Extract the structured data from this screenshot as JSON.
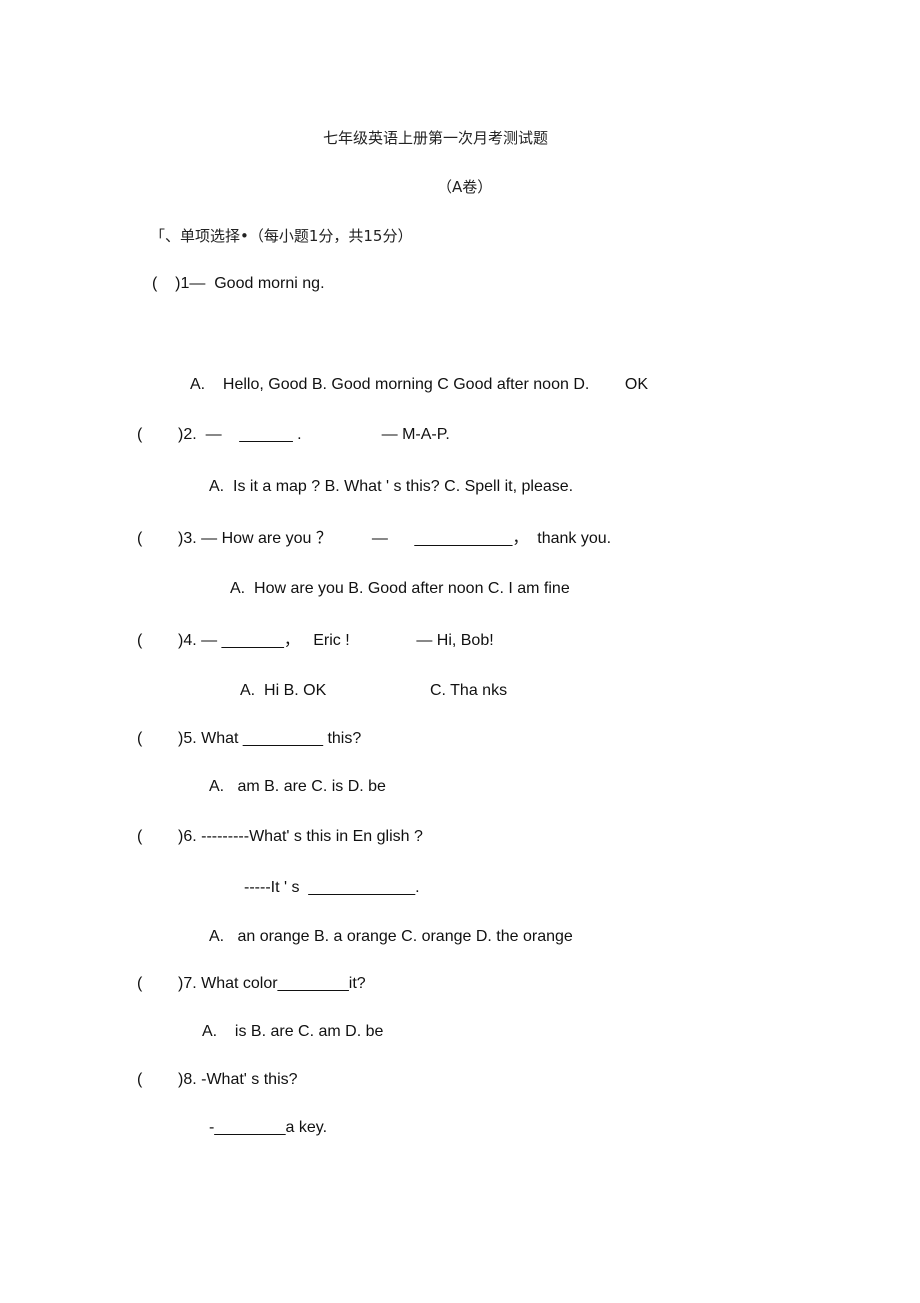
{
  "document": {
    "title": "七年级英语上册第一次月考测试题",
    "subtitle": "（A卷）",
    "section_heading": "「、单项选择•（每小题1分，共15分）"
  },
  "questions": [
    {
      "stem": "(    )1—  Good morni ng.",
      "options": "A.    Hello, Good B. Good morning C Good after noon D.        OK"
    },
    {
      "paren": "(",
      "stem": ")2.  —    ______ .                  — M-A-P.",
      "options": "A.  Is it a map ? B. What ' s this? C. Spell it, please."
    },
    {
      "paren": "(",
      "stem": ")3. — How are you ？         —      ___________，  thank you.",
      "options": "A.  How are you B. Good after noon C. I am fine"
    },
    {
      "paren": "(",
      "stem": ")4. — _______，   Eric !               — Hi, Bob!",
      "options_a": "A.  Hi B. OK",
      "options_c": "C. Tha nks"
    },
    {
      "paren": "(",
      "stem": ")5. What _________ this?",
      "options": "A.   am B. are C. is D. be"
    },
    {
      "paren": "(",
      "stem": ")6. ---------What' s this in En glish ?",
      "answer_line": "-----It ' s  ____________.",
      "options": "A.   an orange B. a orange C. orange D. the orange"
    },
    {
      "paren": "(",
      "stem": ")7. What color________it?",
      "options": "A.    is B. are C. am D. be"
    },
    {
      "paren": "(",
      "stem": ")8. -What' s this?",
      "answer_line": "-________a key."
    }
  ]
}
